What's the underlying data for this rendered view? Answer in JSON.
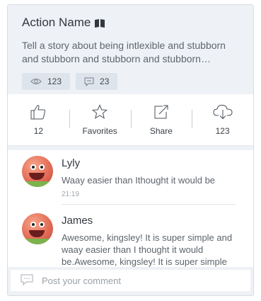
{
  "card": {
    "title": "Action Name",
    "title_icon": "book-icon",
    "description": "Tell a story about being intlexible and stubborn and stubborn and stubborn and stubborn…",
    "stats": {
      "views": "123",
      "comments": "23"
    }
  },
  "actions": [
    {
      "icon": "thumbs-up-icon",
      "label": "12"
    },
    {
      "icon": "star-icon",
      "label": "Favorites"
    },
    {
      "icon": "share-icon",
      "label": "Share"
    },
    {
      "icon": "cloud-download-icon",
      "label": "123"
    }
  ],
  "comments": [
    {
      "name": "Lyly",
      "text": "Waay easier than Ithought it would be",
      "time": "21:19"
    },
    {
      "name": "James",
      "text": "Awesome, kingsley! It is super simple and waay easier than I thought it would be.Awesome, kingsley! It is super simple"
    }
  ],
  "footer": {
    "placeholder": "Post your comment",
    "icon": "comment-icon"
  },
  "colors": {
    "header_bg": "#eef1f5",
    "badge_bg": "#dde4ec",
    "text": "#3a3f45"
  }
}
